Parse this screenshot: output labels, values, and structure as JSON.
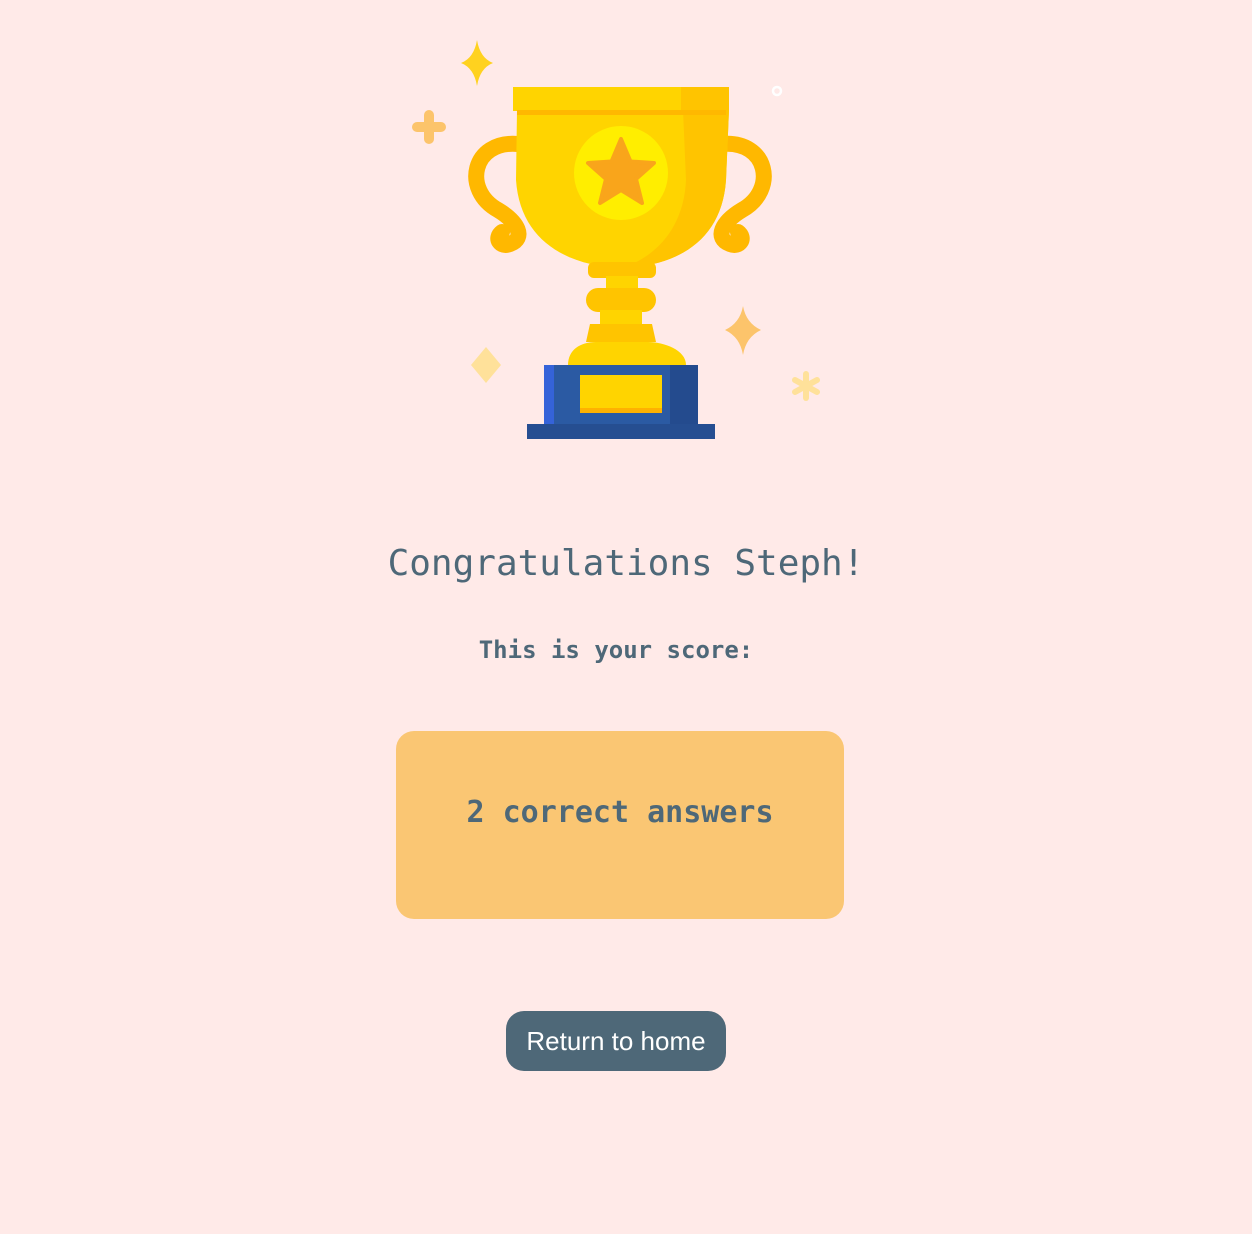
{
  "result": {
    "headline": "Congratulations Steph!",
    "subline": "This is your score:",
    "score_text": "2 correct answers"
  },
  "actions": {
    "return_label": "Return to home"
  },
  "illustration": {
    "icon": "trophy-icon",
    "decorations": [
      "sparkle-icon",
      "plus-icon",
      "diamond-icon",
      "asterisk-icon",
      "ring-icon"
    ]
  },
  "colors": {
    "background": "#ffeae8",
    "text": "#4e6878",
    "score_card": "#fac673",
    "button": "#4e6878",
    "button_text": "#ffffff",
    "trophy_gold": "#ffd400",
    "trophy_shadow": "#ffb800",
    "trophy_base": "#2b54a0"
  }
}
